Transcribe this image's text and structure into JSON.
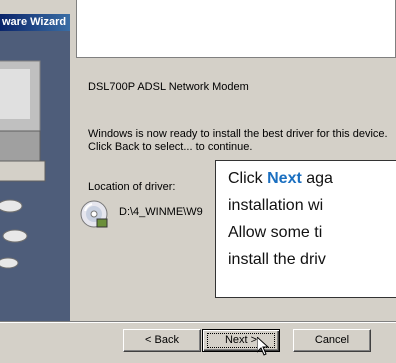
{
  "window": {
    "title": "ware Wizard"
  },
  "device": {
    "name": "DSL700P ADSL Network Modem"
  },
  "message": {
    "ready": "Windows is now ready to install the best driver for this device. Click Back to select... to continue."
  },
  "location": {
    "label": "Location of driver:",
    "path": "D:\\4_WINME\\W9"
  },
  "callout": {
    "line1_pre": "Click ",
    "line1_next": "Next",
    "line1_post": " aga",
    "line2": "installation wi",
    "line3": "Allow some ti",
    "line4": "install the driv"
  },
  "buttons": {
    "back": "< Back",
    "next": "Next >",
    "cancel": "Cancel"
  },
  "colors": {
    "title_bar": "#0a246a",
    "left_pane": "#4e5d7a",
    "callout_accent": "#1a6fc0"
  },
  "icons": {
    "driver": "cd-disc-icon",
    "cursor": "mouse-pointer-icon"
  }
}
